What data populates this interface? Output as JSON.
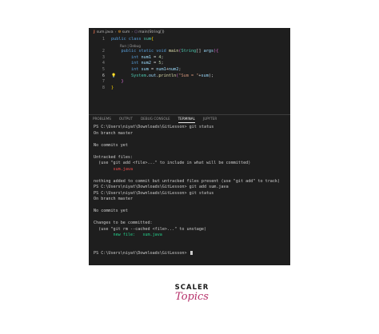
{
  "breadcrumb": {
    "file": "sum.java",
    "class_name": "sum",
    "method_name": "main(String[])"
  },
  "editor": {
    "lines": [
      {
        "number": "1",
        "tokens": [
          {
            "t": "public class ",
            "c": "kw"
          },
          {
            "t": "sum",
            "c": "ty"
          },
          {
            "t": "{",
            "c": "br"
          }
        ]
      },
      {
        "lens": "Run | Debug"
      },
      {
        "number": "2",
        "tokens": [
          {
            "t": "    public static void ",
            "c": "kw"
          },
          {
            "t": "main",
            "c": "fn"
          },
          {
            "t": "(",
            "c": "br2"
          },
          {
            "t": "String",
            "c": "ty"
          },
          {
            "t": "[] ",
            "c": "pl"
          },
          {
            "t": "args",
            "c": "var"
          },
          {
            "t": "){",
            "c": "br2"
          }
        ]
      },
      {
        "number": "3",
        "tokens": [
          {
            "t": "        int ",
            "c": "kw"
          },
          {
            "t": "num1",
            "c": "var"
          },
          {
            "t": " = ",
            "c": "pl"
          },
          {
            "t": "4",
            "c": "num"
          },
          {
            "t": ";",
            "c": "pl"
          }
        ]
      },
      {
        "number": "4",
        "tokens": [
          {
            "t": "        int ",
            "c": "kw"
          },
          {
            "t": "num2",
            "c": "var"
          },
          {
            "t": " = ",
            "c": "pl"
          },
          {
            "t": "5",
            "c": "num"
          },
          {
            "t": ";",
            "c": "pl"
          }
        ]
      },
      {
        "number": "5",
        "tokens": [
          {
            "t": "        int ",
            "c": "kw"
          },
          {
            "t": "sum",
            "c": "var"
          },
          {
            "t": " = ",
            "c": "pl"
          },
          {
            "t": "num1",
            "c": "var"
          },
          {
            "t": "+",
            "c": "pl"
          },
          {
            "t": "num2",
            "c": "var"
          },
          {
            "t": ";",
            "c": "pl"
          }
        ]
      },
      {
        "number": "6",
        "active": true,
        "bulb": true,
        "tokens": [
          {
            "t": "        System",
            "c": "ty"
          },
          {
            "t": ".",
            "c": "pl"
          },
          {
            "t": "out",
            "c": "var"
          },
          {
            "t": ".",
            "c": "pl"
          },
          {
            "t": "println",
            "c": "fn"
          },
          {
            "t": "(",
            "c": "br2"
          },
          {
            "t": "\"Sum = \"",
            "c": "str"
          },
          {
            "t": "+",
            "c": "pl"
          },
          {
            "t": "sum",
            "c": "var"
          },
          {
            "t": ");",
            "c": "pl"
          }
        ]
      },
      {
        "number": "7",
        "tokens": [
          {
            "t": "    }",
            "c": "br2"
          }
        ]
      },
      {
        "number": "8",
        "tokens": [
          {
            "t": "}",
            "c": "br"
          }
        ]
      }
    ]
  },
  "panel": {
    "tabs": [
      {
        "label": "PROBLEMS",
        "active": false
      },
      {
        "label": "OUTPUT",
        "active": false
      },
      {
        "label": "DEBUG CONSOLE",
        "active": false
      },
      {
        "label": "TERMINAL",
        "active": true
      },
      {
        "label": "JUPYTER",
        "active": false
      }
    ]
  },
  "terminal": {
    "lines": [
      {
        "text": "PS C:\\Users\\niyat\\Downloads\\GitLesson> git status"
      },
      {
        "text": "On branch master"
      },
      {
        "text": ""
      },
      {
        "text": "No commits yet"
      },
      {
        "text": ""
      },
      {
        "text": "Untracked files:"
      },
      {
        "text": "  (use \"git add <file>...\" to include in what will be committed)"
      },
      {
        "text": "        sum.java",
        "color": "red"
      },
      {
        "text": ""
      },
      {
        "text": "nothing added to commit but untracked files present (use \"git add\" to track)"
      },
      {
        "text": "PS C:\\Users\\niyat\\Downloads\\GitLesson> git add sum.java"
      },
      {
        "text": "PS C:\\Users\\niyat\\Downloads\\GitLesson> git status"
      },
      {
        "text": "On branch master"
      },
      {
        "text": ""
      },
      {
        "text": "No commits yet"
      },
      {
        "text": ""
      },
      {
        "text": "Changes to be committed:"
      },
      {
        "text": "  (use \"git rm --cached <file>...\" to unstage)"
      },
      {
        "text": "        new file:   sum.java",
        "color": "green"
      },
      {
        "text": ""
      },
      {
        "text": ""
      },
      {
        "text": "PS C:\\Users\\niyat\\Downloads\\GitLesson> ",
        "cursor": true
      }
    ]
  },
  "logo": {
    "top": "SCALER",
    "bottom": "Topics"
  }
}
